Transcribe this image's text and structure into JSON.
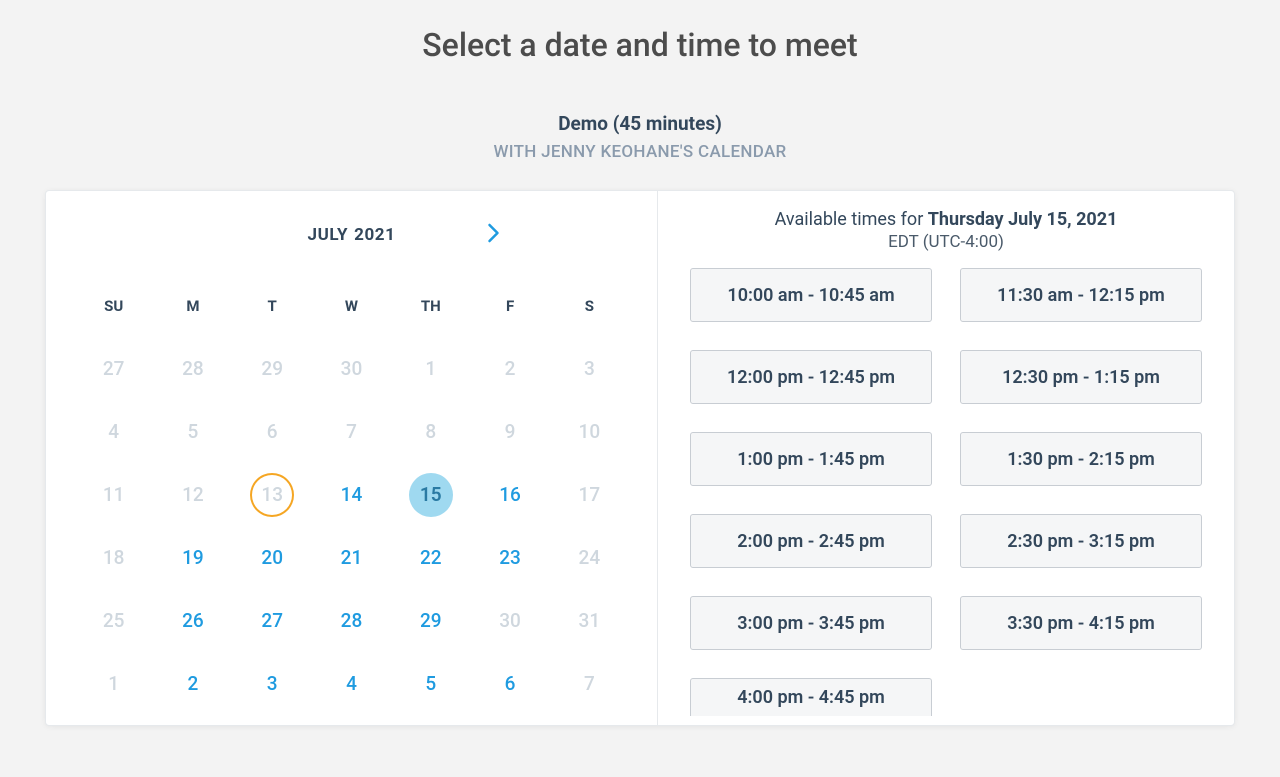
{
  "header": {
    "title": "Select a date and time to meet",
    "meeting_type": "Demo (45 minutes)",
    "with_label": "WITH JENNY KEOHANE'S CALENDAR"
  },
  "calendar": {
    "month": "JULY",
    "year": "2021",
    "dow": [
      "SU",
      "M",
      "T",
      "W",
      "TH",
      "F",
      "S"
    ],
    "weeks": [
      [
        {
          "n": "27",
          "avail": false
        },
        {
          "n": "28",
          "avail": false
        },
        {
          "n": "29",
          "avail": false
        },
        {
          "n": "30",
          "avail": false
        },
        {
          "n": "1",
          "avail": false
        },
        {
          "n": "2",
          "avail": false
        },
        {
          "n": "3",
          "avail": false
        }
      ],
      [
        {
          "n": "4",
          "avail": false
        },
        {
          "n": "5",
          "avail": false
        },
        {
          "n": "6",
          "avail": false
        },
        {
          "n": "7",
          "avail": false
        },
        {
          "n": "8",
          "avail": false
        },
        {
          "n": "9",
          "avail": false
        },
        {
          "n": "10",
          "avail": false
        }
      ],
      [
        {
          "n": "11",
          "avail": false
        },
        {
          "n": "12",
          "avail": false
        },
        {
          "n": "13",
          "avail": false,
          "today": true
        },
        {
          "n": "14",
          "avail": true
        },
        {
          "n": "15",
          "avail": true,
          "selected": true
        },
        {
          "n": "16",
          "avail": true
        },
        {
          "n": "17",
          "avail": false
        }
      ],
      [
        {
          "n": "18",
          "avail": false
        },
        {
          "n": "19",
          "avail": true
        },
        {
          "n": "20",
          "avail": true
        },
        {
          "n": "21",
          "avail": true
        },
        {
          "n": "22",
          "avail": true
        },
        {
          "n": "23",
          "avail": true
        },
        {
          "n": "24",
          "avail": false
        }
      ],
      [
        {
          "n": "25",
          "avail": false
        },
        {
          "n": "26",
          "avail": true
        },
        {
          "n": "27",
          "avail": true
        },
        {
          "n": "28",
          "avail": true
        },
        {
          "n": "29",
          "avail": true
        },
        {
          "n": "30",
          "avail": false
        },
        {
          "n": "31",
          "avail": false
        }
      ],
      [
        {
          "n": "1",
          "avail": false
        },
        {
          "n": "2",
          "avail": true
        },
        {
          "n": "3",
          "avail": true
        },
        {
          "n": "4",
          "avail": true
        },
        {
          "n": "5",
          "avail": true
        },
        {
          "n": "6",
          "avail": true
        },
        {
          "n": "7",
          "avail": false
        }
      ]
    ]
  },
  "times": {
    "header_prefix": "Available times for ",
    "header_date": "Thursday July 15, 2021",
    "timezone": "EDT (UTC-4:00)",
    "slots": [
      "10:00 am - 10:45 am",
      "11:30 am - 12:15 pm",
      "12:00 pm - 12:45 pm",
      "12:30 pm - 1:15 pm",
      "1:00 pm - 1:45 pm",
      "1:30 pm - 2:15 pm",
      "2:00 pm - 2:45 pm",
      "2:30 pm - 3:15 pm",
      "3:00 pm - 3:45 pm",
      "3:30 pm - 4:15 pm",
      "4:00 pm - 4:45 pm"
    ]
  }
}
